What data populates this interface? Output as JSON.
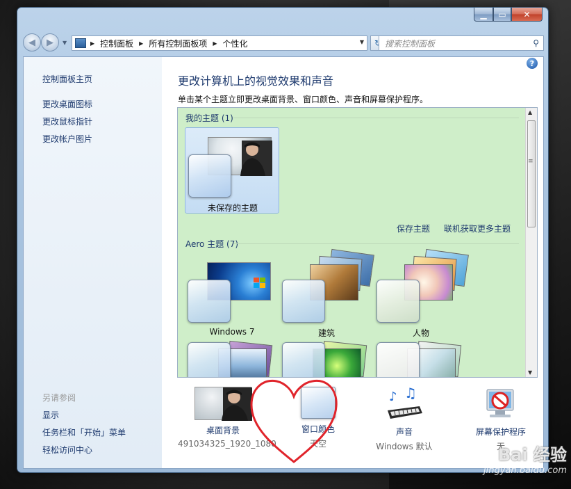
{
  "address_bar": {
    "breadcrumbs": [
      "控制面板",
      "所有控制面板项",
      "个性化"
    ]
  },
  "search": {
    "placeholder": "搜索控制面板"
  },
  "sidebar": {
    "items": [
      "控制面板主页",
      "更改桌面图标",
      "更改鼠标指针",
      "更改帐户图片"
    ],
    "see_also_heading": "另请参阅",
    "see_also_items": [
      "显示",
      "任务栏和「开始」菜单",
      "轻松访问中心"
    ]
  },
  "main": {
    "title": "更改计算机上的视觉效果和声音",
    "description": "单击某个主题立即更改桌面背景、窗口颜色、声音和屏幕保护程序。"
  },
  "themes": {
    "my_themes_heading": "我的主题 (1)",
    "my_themes": [
      {
        "label": "未保存的主题"
      }
    ],
    "save_theme_link": "保存主题",
    "online_themes_link": "联机获取更多主题",
    "aero_heading": "Aero 主题 (7)",
    "aero_themes": [
      {
        "label": "Windows 7"
      },
      {
        "label": "建筑"
      },
      {
        "label": "人物"
      }
    ]
  },
  "bottom_toolbar": {
    "desktop_background": {
      "label": "桌面背景",
      "sub": "491034325_1920_1080"
    },
    "window_color": {
      "label": "窗口颜色",
      "sub": "天空"
    },
    "sounds": {
      "label": "声音",
      "sub": "Windows 默认"
    },
    "screensaver": {
      "label": "屏幕保护程序",
      "sub": "无"
    }
  },
  "watermark": {
    "main": "Bai 经验",
    "sub": "jingyan.baidu.com"
  },
  "colors": {
    "theme_panel_bg": "#cfeec9",
    "link_color": "#1e3a6e",
    "annotation_heart": "#e0242b"
  }
}
